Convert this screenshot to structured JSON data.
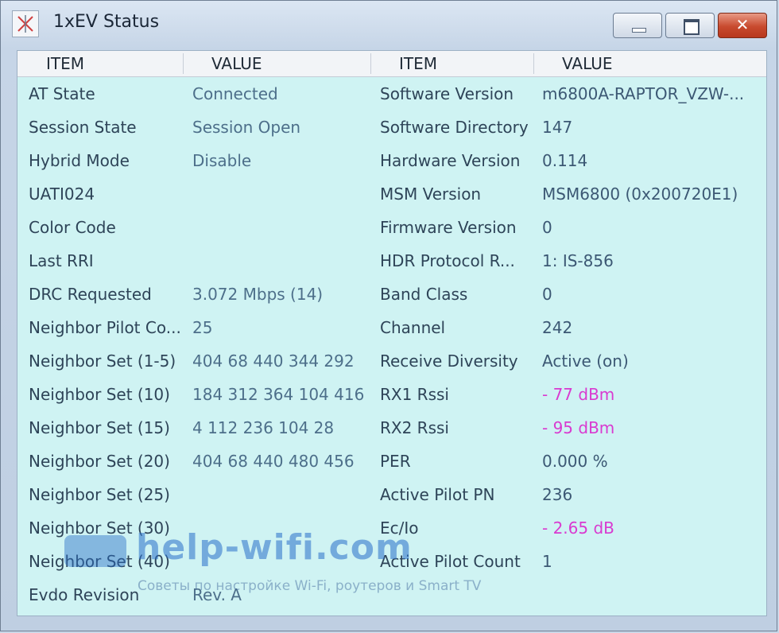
{
  "window": {
    "title": "1xEV Status",
    "buttons": {
      "close_glyph": "✕"
    }
  },
  "columns": {
    "item_header": "ITEM",
    "value_header": "VALUE"
  },
  "left_rows": [
    {
      "item": "AT State",
      "value": "Connected"
    },
    {
      "item": "Session State",
      "value": "Session Open"
    },
    {
      "item": "Hybrid Mode",
      "value": "Disable"
    },
    {
      "item": "UATI024",
      "value": ""
    },
    {
      "item": "Color Code",
      "value": ""
    },
    {
      "item": "Last RRI",
      "value": ""
    },
    {
      "item": "DRC Requested",
      "value": "3.072 Mbps (14)"
    },
    {
      "item": "Neighbor Pilot Co...",
      "value": "25"
    },
    {
      "item": "Neighbor Set (1-5)",
      "value": "404 68 440 344 292"
    },
    {
      "item": "Neighbor Set (10)",
      "value": "184 312 364 104 416"
    },
    {
      "item": "Neighbor Set (15)",
      "value": "4 112 236 104 28"
    },
    {
      "item": "Neighbor Set (20)",
      "value": "404 68 440 480 456"
    },
    {
      "item": "Neighbor Set (25)",
      "value": ""
    },
    {
      "item": "Neighbor Set (30)",
      "value": ""
    },
    {
      "item": "Neighbor Set (40)",
      "value": ""
    },
    {
      "item": "Evdo Revision",
      "value": "Rev. A"
    }
  ],
  "right_rows": [
    {
      "item": "Software Version",
      "value": "m6800A-RAPTOR_VZW-..."
    },
    {
      "item": "Software Directory",
      "value": "147"
    },
    {
      "item": "Hardware Version",
      "value": "0.114"
    },
    {
      "item": "MSM Version",
      "value": "MSM6800 (0x200720E1)"
    },
    {
      "item": "Firmware Version",
      "value": "0"
    },
    {
      "item": "HDR Protocol R...",
      "value": "1: IS-856"
    },
    {
      "item": "Band Class",
      "value": "0"
    },
    {
      "item": "Channel",
      "value": "242"
    },
    {
      "item": "Receive Diversity",
      "value": "Active (on)"
    },
    {
      "item": "RX1 Rssi",
      "value": "- 77 dBm",
      "highlight": true
    },
    {
      "item": "RX2 Rssi",
      "value": "- 95 dBm",
      "highlight": true
    },
    {
      "item": "PER",
      "value": "0.000 %"
    },
    {
      "item": "Active Pilot PN",
      "value": "236"
    },
    {
      "item": "Ec/Io",
      "value": "- 2.65 dB",
      "highlight": true
    },
    {
      "item": "Active Pilot Count",
      "value": "1"
    }
  ],
  "watermark": {
    "text": "help-wifi.com",
    "subtitle": "Советы по настройке Wi-Fi, роутеров и Smart TV"
  },
  "colors": {
    "panel_bg": "#cff3f3",
    "highlight": "#d93ad0",
    "close_button": "#c84a2e"
  }
}
